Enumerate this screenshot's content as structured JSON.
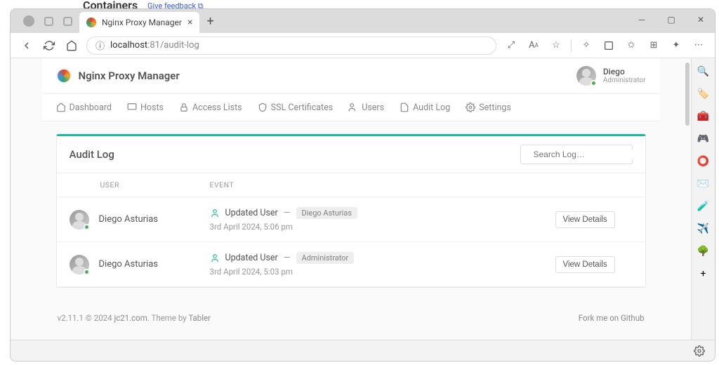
{
  "bg": {
    "heading": "Containers",
    "link": "Give feedback ⧉"
  },
  "tab": {
    "title": "Nginx Proxy Manager"
  },
  "url": {
    "icon": "ⓘ",
    "host": "localhost",
    "port": ":81",
    "path": "/audit-log"
  },
  "app": {
    "title": "Nginx Proxy Manager",
    "user": {
      "name": "Diego",
      "role": "Administrator"
    },
    "nav": [
      {
        "label": "Dashboard"
      },
      {
        "label": "Hosts"
      },
      {
        "label": "Access Lists"
      },
      {
        "label": "SSL Certificates"
      },
      {
        "label": "Users"
      },
      {
        "label": "Audit Log"
      },
      {
        "label": "Settings"
      }
    ]
  },
  "card": {
    "title": "Audit Log",
    "search_placeholder": "Search Log…",
    "columns": {
      "user": "USER",
      "event": "EVENT"
    },
    "view_label": "View Details"
  },
  "rows": [
    {
      "user": "Diego Asturias",
      "action": "Updated User",
      "target": "Diego Asturias",
      "time": "3rd April 2024, 5:06 pm"
    },
    {
      "user": "Diego Asturias",
      "action": "Updated User",
      "target": "Administrator",
      "time": "3rd April 2024, 5:03 pm"
    }
  ],
  "footer": {
    "version": "v2.11.1 © 2024 ",
    "link1": "jc21.com",
    "theme": ". Theme by ",
    "link2": "Tabler",
    "fork": "Fork me on Github"
  },
  "rail": [
    "🔍",
    "🏷️",
    "🧰",
    "🎮",
    "⭕",
    "✉️",
    "🧪",
    "✈️",
    "🌳",
    "+"
  ]
}
